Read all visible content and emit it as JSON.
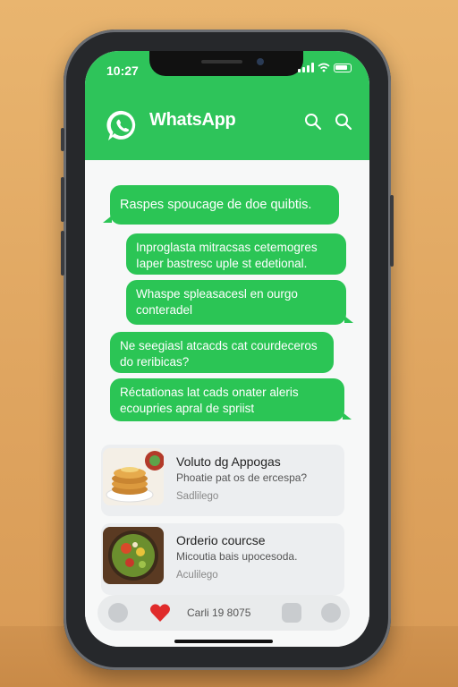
{
  "status_bar": {
    "time": "10:27"
  },
  "header": {
    "app_title": "WhatsApp"
  },
  "messages": [
    {
      "text": "Raspes spoucage de doe quibtis."
    },
    {
      "text": "Inproglasta mitracsas cetemogres Iaper bastresc uple st edetional."
    },
    {
      "text": "Whaspe spleasacesl en ourgo conteradel"
    },
    {
      "text": "Ne seegiasl atcacds cat courdeceros do reribicas?"
    },
    {
      "text": "Réctationas lat cads onater aleris ecoupries apral de spriist"
    }
  ],
  "cards": [
    {
      "title": "Voluto dg Appogas",
      "subtitle": "Phoatie pat os de ercespa?",
      "meta": "Sadlilego"
    },
    {
      "title": "Orderio courcse",
      "subtitle": "Micoutia bais upocesoda.",
      "meta": "Aculilego"
    }
  ],
  "bottom_bar": {
    "text": "Carli 19 8075"
  },
  "colors": {
    "brand_green": "#2ec45a",
    "bubble_green": "#2bc555",
    "heart_red": "#e02b2b"
  }
}
